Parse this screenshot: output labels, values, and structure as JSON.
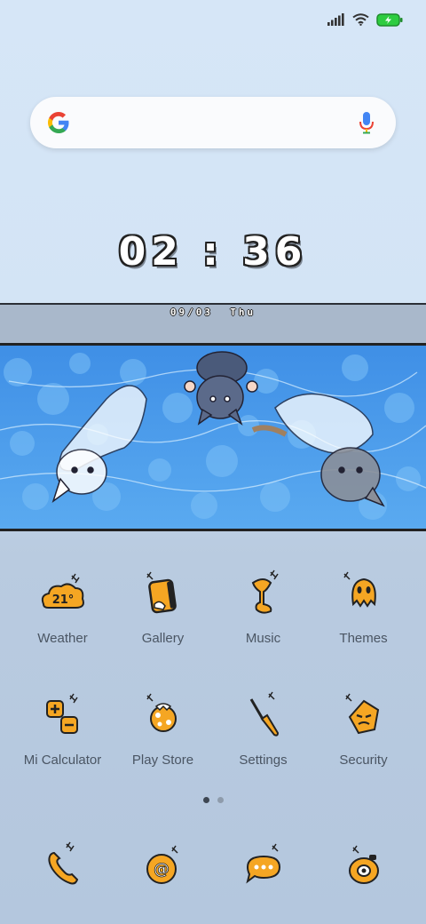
{
  "status_bar": {
    "signal": "signal-icon",
    "wifi": "wifi-icon",
    "battery": "battery-charging-icon"
  },
  "search": {
    "logo": "google-g-icon",
    "mic": "mic-icon"
  },
  "clock": {
    "time": "02 : 36",
    "date": "09/03",
    "weekday": "Thu"
  },
  "apps": [
    {
      "label": "Weather",
      "icon": "weather-icon",
      "temp": "21°"
    },
    {
      "label": "Gallery",
      "icon": "gallery-icon"
    },
    {
      "label": "Music",
      "icon": "music-icon"
    },
    {
      "label": "Themes",
      "icon": "themes-icon"
    },
    {
      "label": "Mi Calculator",
      "icon": "calculator-icon"
    },
    {
      "label": "Play Store",
      "icon": "play-store-icon"
    },
    {
      "label": "Settings",
      "icon": "settings-icon"
    },
    {
      "label": "Security",
      "icon": "security-icon"
    }
  ],
  "page_indicator": {
    "pages": 2,
    "current": 1
  },
  "dock": [
    {
      "icon": "phone-icon"
    },
    {
      "icon": "browser-icon"
    },
    {
      "icon": "messages-icon"
    },
    {
      "icon": "camera-icon"
    }
  ],
  "colors": {
    "icon_fill": "#f5a623",
    "outline": "#222222",
    "water": "#4a9be8"
  }
}
